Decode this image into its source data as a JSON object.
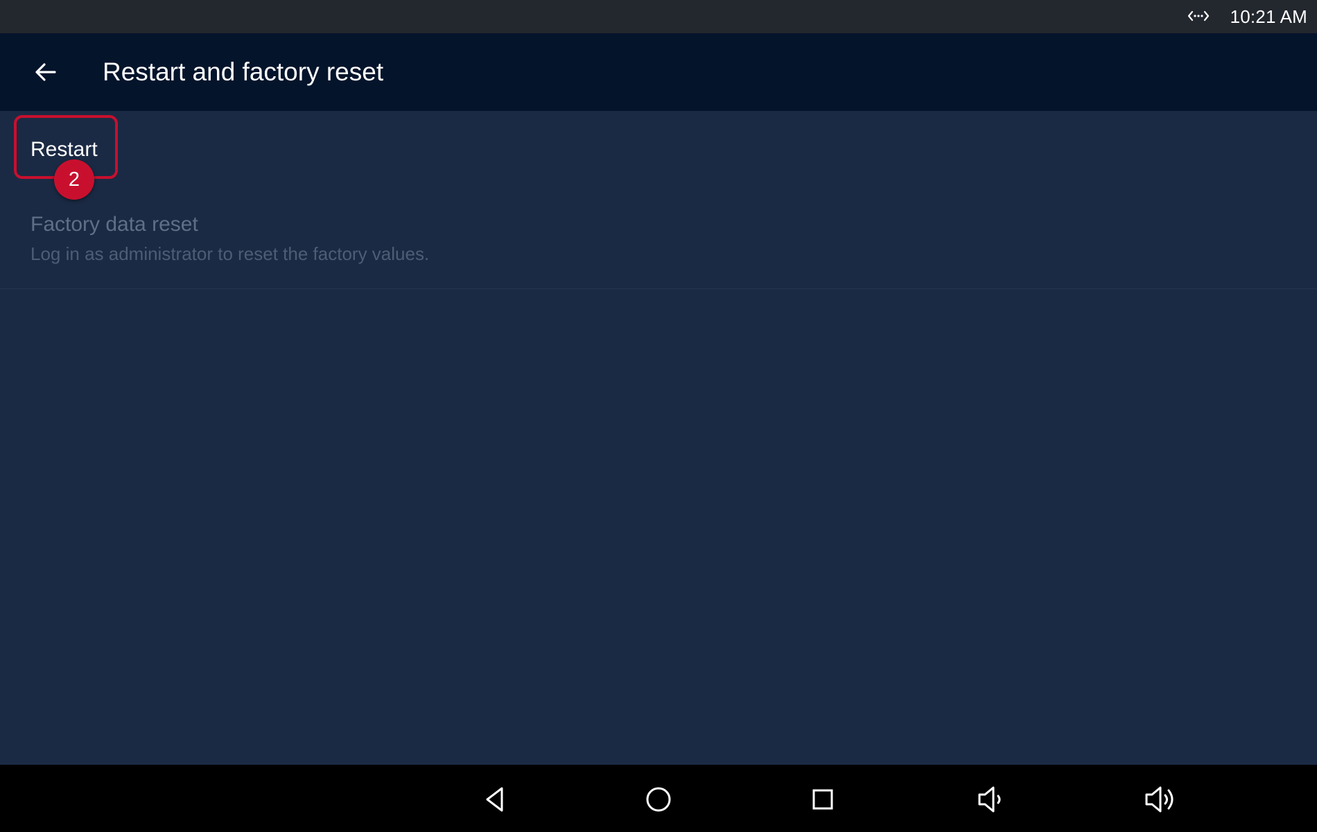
{
  "status_bar": {
    "icon": "code-sync-icon",
    "time": "10:21 AM"
  },
  "app_bar": {
    "back_icon": "back-arrow-icon",
    "title": "Restart and factory reset"
  },
  "settings": {
    "restart": {
      "label": "Restart",
      "step_badge": "2",
      "highlight_color": "#c8102e"
    },
    "factory_reset": {
      "title": "Factory data reset",
      "subtitle": "Log in as administrator to reset the factory values.",
      "enabled": false
    }
  },
  "nav_bar": {
    "buttons": [
      "back-triangle-icon",
      "home-circle-icon",
      "recents-square-icon",
      "volume-down-icon",
      "volume-up-icon"
    ]
  },
  "colors": {
    "status_bar": "#23272e",
    "app_bar": "#04142b",
    "content_bg": "#1b2a44",
    "nav_bar": "#000000",
    "accent": "#c8102e"
  }
}
